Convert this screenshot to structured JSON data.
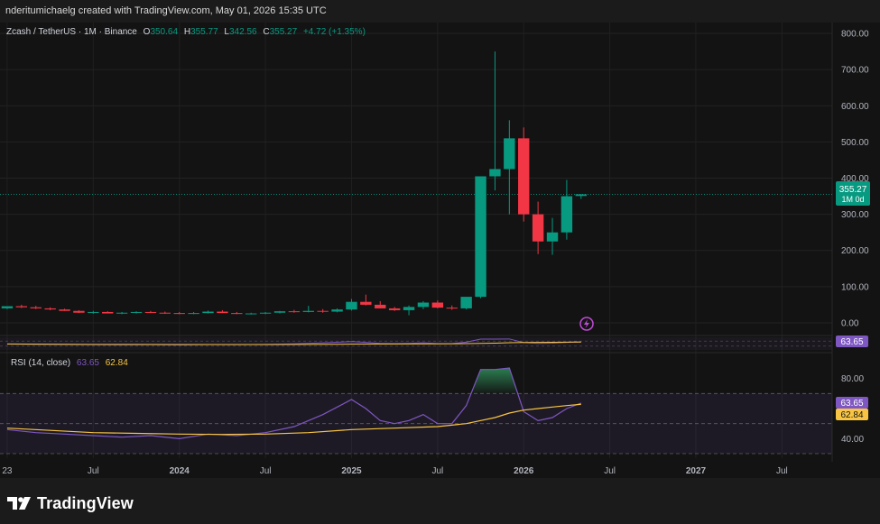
{
  "header": {
    "credit": "nderitumichaelg created with TradingView.com, May 01, 2026 15:35 UTC"
  },
  "legend": {
    "symbol": "Zcash / TetherUS · 1M · Binance",
    "open_label": "O",
    "open_value": "350.64",
    "high_label": "H",
    "high_value": "355.77",
    "low_label": "L",
    "low_value": "342.56",
    "close_label": "C",
    "close_value": "355.27",
    "change": "+4.72 (+1.35%)"
  },
  "price_badge": {
    "price": "355.27",
    "countdown": "1M 0d"
  },
  "rsi": {
    "label": "RSI (14, close)",
    "rsi_value": "63.65",
    "ma_value": "62.84"
  },
  "footer": {
    "brand": "TradingView"
  },
  "colors": {
    "up": "#089981",
    "down": "#f23645",
    "rsi_line": "#7e57c2",
    "rsi_ma": "#f7c543",
    "rsi_badge": "#7e57c2",
    "ma_badge": "#f7c543",
    "price_badge": "#089981"
  },
  "chart_data": [
    {
      "type": "candlestick",
      "title": "Zcash / TetherUS · 1M · Binance",
      "y_ticks": [
        "800.00",
        "700.00",
        "600.00",
        "500.00",
        "400.00",
        "300.00",
        "200.00",
        "100.00",
        "0.00"
      ],
      "ylim": [
        -30,
        830
      ],
      "x_labels": [
        "23",
        "Jul",
        "2024",
        "Jul",
        "2025",
        "Jul",
        "2026",
        "Jul",
        "2027",
        "Jul"
      ],
      "x_label_months": [
        0,
        6,
        12,
        18,
        24,
        30,
        36,
        42,
        48,
        54
      ],
      "x_label_bold": [
        false,
        false,
        true,
        false,
        true,
        false,
        true,
        false,
        true,
        false
      ],
      "x_range_months": [
        -0.5,
        57.5
      ],
      "grid": true,
      "months": [
        "2023-01",
        "2023-02",
        "2023-03",
        "2023-04",
        "2023-05",
        "2023-06",
        "2023-07",
        "2023-08",
        "2023-09",
        "2023-10",
        "2023-11",
        "2023-12",
        "2024-01",
        "2024-02",
        "2024-03",
        "2024-04",
        "2024-05",
        "2024-06",
        "2024-07",
        "2024-08",
        "2024-09",
        "2024-10",
        "2024-11",
        "2024-12",
        "2025-01",
        "2025-02",
        "2025-03",
        "2025-04",
        "2025-05",
        "2025-06",
        "2025-07",
        "2025-08",
        "2025-09",
        "2025-10",
        "2025-11",
        "2025-12",
        "2026-01",
        "2026-02",
        "2026-03",
        "2026-04",
        "2026-05"
      ],
      "open": [
        40,
        46,
        43,
        40,
        37,
        33,
        28,
        30,
        26,
        28,
        30,
        28,
        27,
        25,
        27,
        31,
        27,
        25,
        26,
        28,
        32,
        30,
        33,
        31,
        37,
        58,
        50,
        40,
        35,
        44,
        56,
        42,
        40,
        72,
        405,
        425,
        510,
        300,
        225,
        250,
        350.64
      ],
      "high": [
        46,
        50,
        47,
        43,
        39,
        35,
        33,
        32,
        30,
        32,
        33,
        31,
        30,
        30,
        34,
        35,
        30,
        28,
        30,
        33,
        36,
        47,
        38,
        40,
        66,
        78,
        60,
        44,
        48,
        60,
        62,
        48,
        58,
        405,
        750,
        560,
        540,
        335,
        290,
        395,
        355.77
      ],
      "low": [
        38,
        41,
        38,
        35,
        33,
        27,
        25,
        26,
        24,
        26,
        27,
        25,
        24,
        24,
        26,
        27,
        24,
        23,
        24,
        26,
        28,
        29,
        28,
        29,
        34,
        48,
        40,
        33,
        21,
        38,
        40,
        36,
        37,
        68,
        366,
        300,
        280,
        190,
        188,
        230,
        342.56
      ],
      "close": [
        46,
        43,
        40,
        37,
        33,
        28,
        30,
        26,
        28,
        30,
        28,
        27,
        25,
        27,
        31,
        27,
        25,
        26,
        28,
        32,
        30,
        33,
        31,
        37,
        58,
        50,
        40,
        35,
        44,
        56,
        42,
        40,
        72,
        405,
        425,
        510,
        300,
        225,
        250,
        350,
        355.27
      ],
      "last_price": 355.27
    },
    {
      "type": "line",
      "title": "RSI (14, close)",
      "y_ticks": [
        "80.00",
        "40.00"
      ],
      "ylim": [
        27,
        96
      ],
      "bands": {
        "upper": 70,
        "middle": 50,
        "lower": 30
      },
      "series": [
        {
          "name": "RSI",
          "x": [
            0,
            2,
            4,
            6,
            8,
            10,
            12,
            14,
            16,
            18,
            20,
            22,
            24,
            25,
            26,
            27,
            28,
            29,
            30,
            31,
            32,
            33,
            34,
            35,
            36,
            37,
            38,
            39,
            40
          ],
          "values": [
            46,
            44,
            43,
            42,
            41,
            42,
            40,
            43,
            42,
            44,
            48,
            56,
            66,
            60,
            52,
            50,
            52,
            56,
            50,
            50,
            62,
            86,
            86,
            87,
            58,
            52,
            54,
            60,
            63.65
          ]
        },
        {
          "name": "MA",
          "x": [
            0,
            3,
            6,
            9,
            12,
            15,
            18,
            21,
            24,
            27,
            30,
            32,
            33,
            34,
            35,
            36,
            37,
            38,
            39,
            40
          ],
          "values": [
            47,
            45.5,
            44,
            43.5,
            43,
            42.8,
            43,
            44,
            46,
            47,
            48,
            50,
            52,
            54,
            57,
            59,
            60,
            61,
            62,
            62.84
          ]
        }
      ]
    }
  ]
}
